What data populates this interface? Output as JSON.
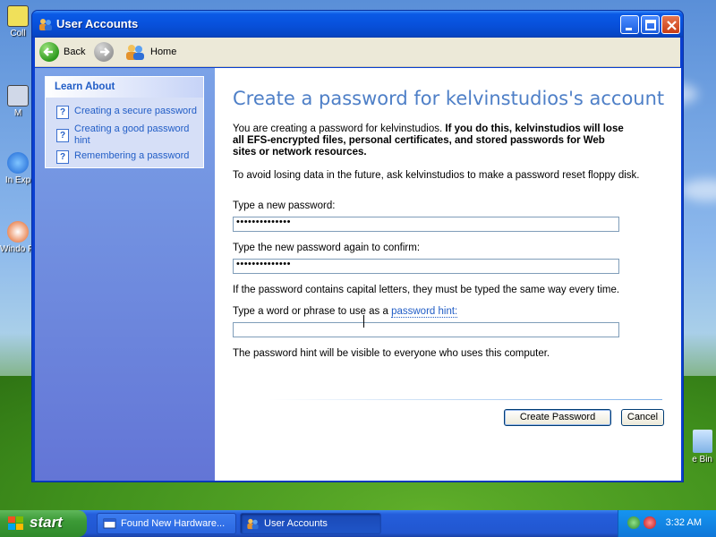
{
  "window": {
    "title": "User Accounts",
    "toolbar": {
      "back": "Back",
      "home": "Home"
    }
  },
  "sidebar": {
    "heading": "Learn About",
    "items": [
      {
        "label": "Creating a secure password"
      },
      {
        "label": "Creating a good password hint"
      },
      {
        "label": "Remembering a password"
      }
    ]
  },
  "main": {
    "heading": "Create a password for kelvinstudios's account",
    "intro_normal": "You are creating a password for kelvinstudios. ",
    "intro_bold": "If you do this, kelvinstudios will lose all EFS-encrypted files, personal certificates, and stored passwords for Web sites or network resources.",
    "reset_note": "To avoid losing data in the future, ask kelvinstudios to make a password reset floppy disk.",
    "new_password_label": "Type a new password:",
    "new_password_value": "••••••••••••••",
    "confirm_label": "Type the new password again to confirm:",
    "confirm_value": "••••••••••••••",
    "case_note": "If the password contains capital letters, they must be typed the same way every time.",
    "hint_label_prefix": "Type a word or phrase to use as a ",
    "hint_link": "password hint:",
    "hint_value": "",
    "hint_note": "The password hint will be visible to everyone who uses this computer.",
    "create_button": "Create Password",
    "cancel_button": "Cancel"
  },
  "desktop": {
    "icons": [
      "Coll",
      "M",
      "In Exp",
      "Windo Pl"
    ],
    "recycle": "e Bin"
  },
  "taskbar": {
    "start": "start",
    "tasks": [
      {
        "label": "Found New Hardware..."
      },
      {
        "label": "User Accounts"
      }
    ],
    "clock": "3:32 AM"
  },
  "colors": {
    "heading": "#4e7fc7",
    "link": "#215dc6",
    "titlebar": "#0851dc",
    "sidepane": "#7ba2e7"
  }
}
